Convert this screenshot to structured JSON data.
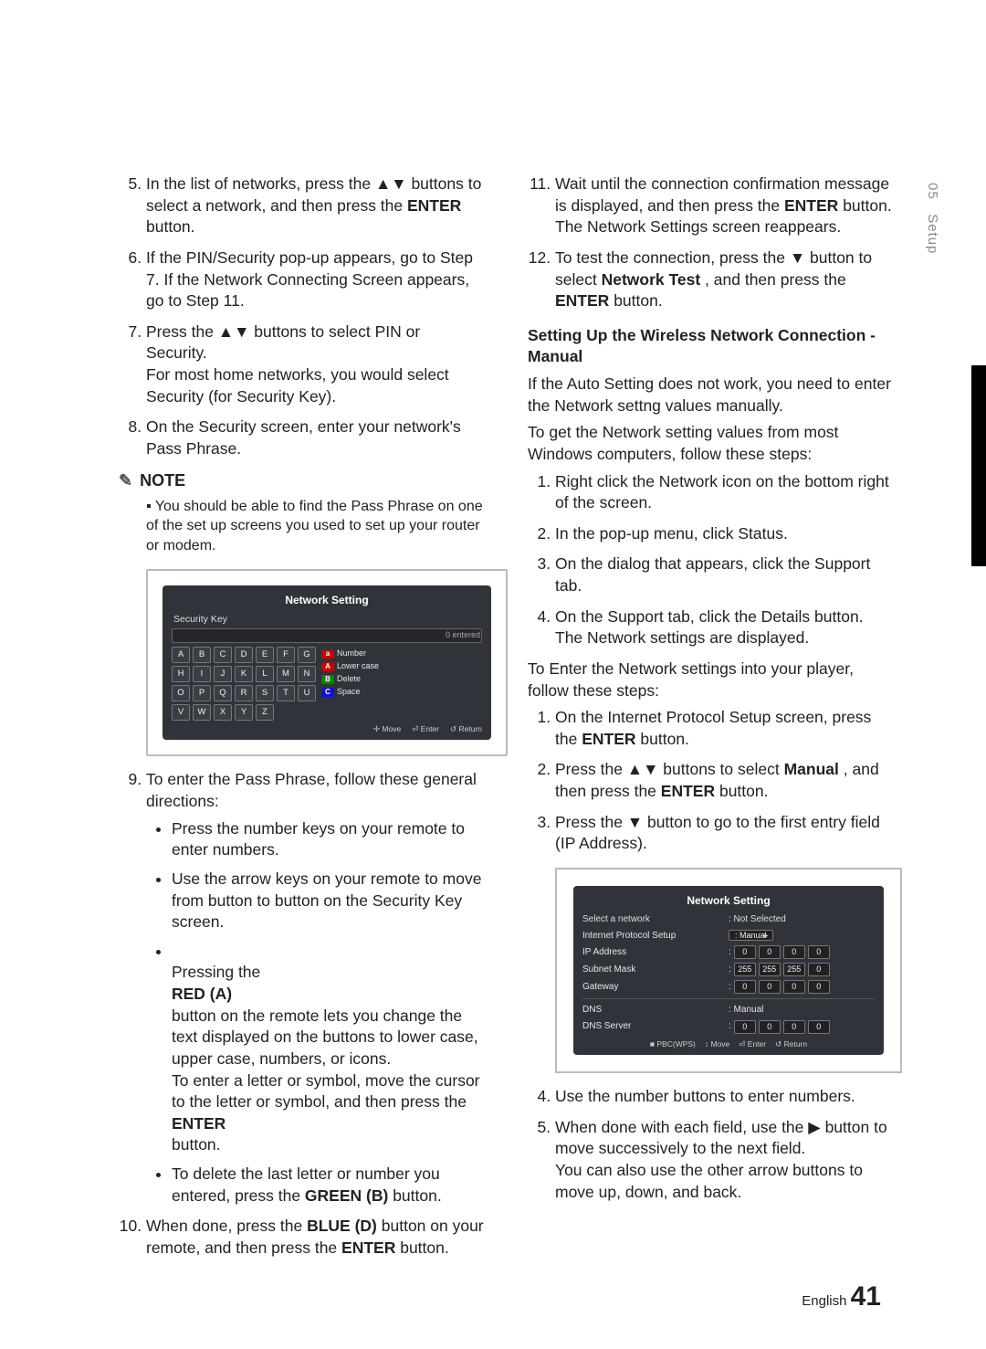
{
  "side": {
    "chapter": "05",
    "section": "Setup"
  },
  "left": {
    "li5_a": "In the list of networks, press the ▲▼ buttons to select a network, and then press the ",
    "li5_b": "ENTER",
    "li5_c": " button.",
    "li6": "If the PIN/Security pop-up appears, go to Step 7. If the Network Connecting Screen appears, go to Step 11.",
    "li7": "Press the ▲▼ buttons to select PIN or Security.\nFor most home networks, you would select Security (for Security Key).",
    "li8": "On the Security screen, enter your network's Pass Phrase.",
    "note_label": "NOTE",
    "note_item": "You should be able to find the Pass Phrase on one of the set up screens you used to set up your router or modem.",
    "li9": "To enter the Pass Phrase, follow these general directions:",
    "b1": "Press the number keys on your remote to enter numbers.",
    "b2": "Use the arrow keys on your remote to move from button to button on the Security Key screen.",
    "b3_a": "Pressing the ",
    "b3_b": "RED (A)",
    "b3_c": " button on the remote lets you change the text displayed on the buttons to lower case, upper case, numbers, or icons.\nTo enter a letter or symbol, move the cursor to the letter or symbol, and then press the ",
    "b3_d": "ENTER",
    "b3_e": " button.",
    "b4_a": "To delete the last letter or number you entered, press the ",
    "b4_b": "GREEN (B)",
    "b4_c": " button.",
    "li10_a": "When done, press the ",
    "li10_b": "BLUE (D)",
    "li10_c": " button on your remote, and then press the ",
    "li10_d": "ENTER",
    "li10_e": " button."
  },
  "fig1": {
    "title": "Network Setting",
    "sub": "Security Key",
    "entered": "0 entered",
    "keys": [
      "A",
      "B",
      "C",
      "D",
      "E",
      "F",
      "G",
      "H",
      "I",
      "J",
      "K",
      "L",
      "M",
      "N",
      "O",
      "P",
      "Q",
      "R",
      "S",
      "T",
      "U",
      "V",
      "W",
      "X",
      "Y",
      "Z"
    ],
    "legend_number": "Number",
    "legend_lower": "Lower case",
    "legend_delete": "Delete",
    "legend_space": "Space",
    "foot_move": "✢ Move",
    "foot_enter": "⏎ Enter",
    "foot_return": "↺ Return",
    "chip_a": "a",
    "chip_A": "A",
    "chip_B": "B",
    "chip_C": "C"
  },
  "right": {
    "li11_a": "Wait until the connection confirmation message is displayed, and then press the ",
    "li11_b": "ENTER",
    "li11_c": " button. The Network Settings screen reappears.",
    "li12_a": "To test the connection, press the ▼ button to select ",
    "li12_b": "Network Test",
    "li12_c": ", and then press the ",
    "li12_d": "ENTER",
    "li12_e": " button.",
    "head": "Setting Up the Wireless Network Connection - Manual",
    "p1": "If the Auto Setting does not work, you need to enter the Network settng values manually.",
    "p2": "To get the Network setting values from most Windows computers, follow these steps:",
    "s1": "Right click the Network icon on the bottom right of the screen.",
    "s2": "In the pop-up menu, click Status.",
    "s3": "On the dialog that appears, click the Support tab.",
    "s4": "On the Support tab, click the Details button. The Network settings are displayed.",
    "p3": "To Enter the Network settings into your player, follow these steps:",
    "t1_a": "On the Internet Protocol Setup screen, press the ",
    "t1_b": "ENTER",
    "t1_c": " button.",
    "t2_a": "Press the ▲▼ buttons to select ",
    "t2_b": "Manual",
    "t2_c": ", and then press the ",
    "t2_d": "ENTER",
    "t2_e": " button.",
    "t3": "Press the ▼ button to go to the first entry field (IP Address).",
    "t4": "Use the number buttons to enter numbers.",
    "t5": "When done with each field, use the ▶ button to move successively to the next field.\nYou can also use the other arrow buttons to move up, down, and back."
  },
  "fig2": {
    "title": "Network Setting",
    "row_sel_l": "Select a network",
    "row_sel_v": ": Not Selected",
    "row_ips_l": "Internet Protocol Setup",
    "row_ips_v": ": Manual",
    "row_ip_l": "IP Address",
    "row_sm_l": "Subnet Mask",
    "row_gw_l": "Gateway",
    "row_dns_l": "DNS",
    "row_dns_v": ": Manual",
    "row_dnss_l": "DNS Server",
    "ip_zero": "0",
    "ip_255": "255",
    "foot_pbc": "■ PBC(WPS)",
    "foot_move": "↕ Move",
    "foot_enter": "⏎ Enter",
    "foot_return": "↺ Return"
  },
  "footer": {
    "lang": "English",
    "page": "41"
  }
}
